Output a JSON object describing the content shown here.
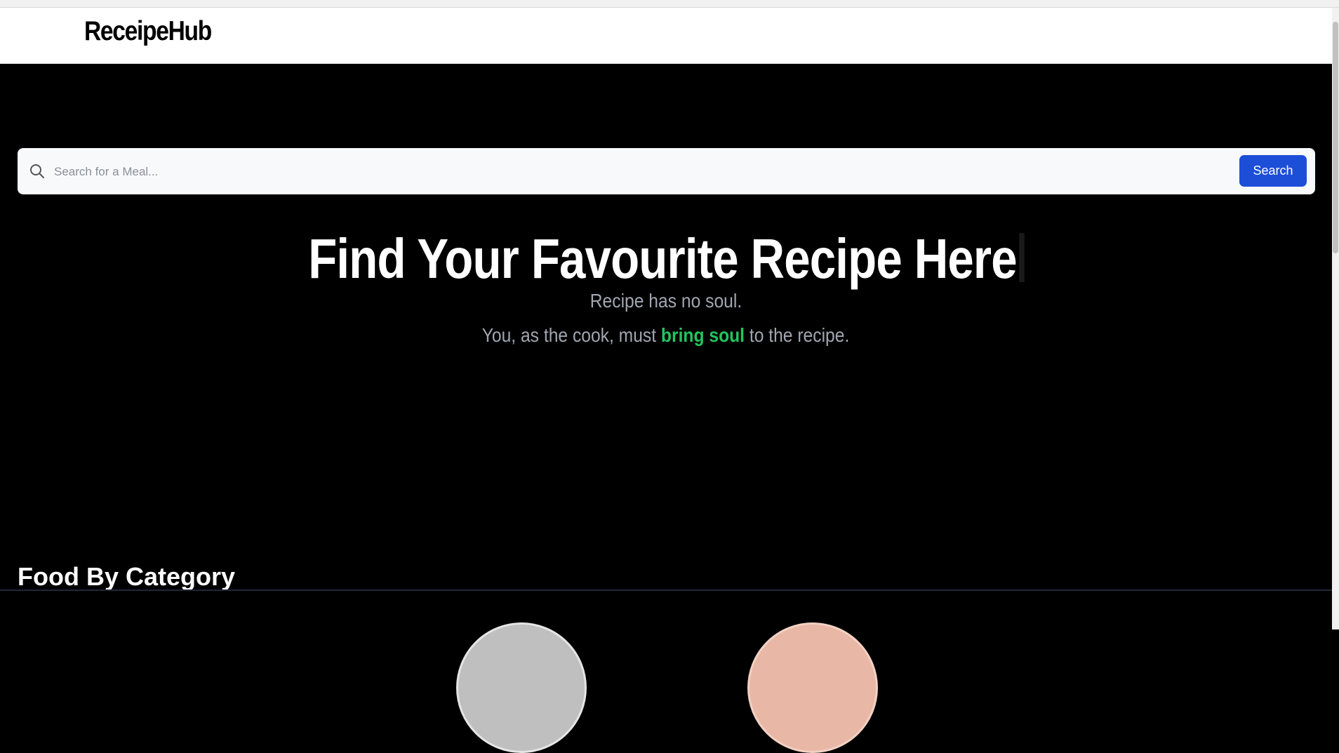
{
  "brand": {
    "name": "ReceipeHub"
  },
  "search": {
    "placeholder": "Search for a Meal...",
    "button_label": "Search",
    "icon": "search-icon"
  },
  "hero": {
    "title": "Find Your Favourite Recipe Here",
    "line1": "Recipe has no soul.",
    "line2_before": "You, as the cook, must ",
    "line2_highlight": "bring soul",
    "line2_after": " to the recipe."
  },
  "section": {
    "title": "Food By Category"
  },
  "colors": {
    "accent": "#1d4ed8",
    "highlight": "#22c55e",
    "background": "#000000"
  }
}
